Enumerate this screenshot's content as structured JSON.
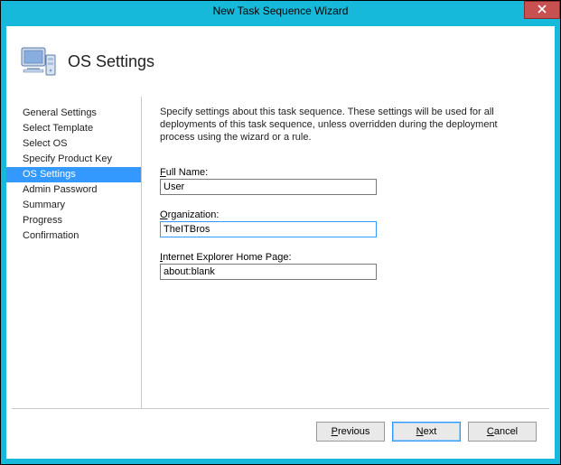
{
  "window": {
    "title": "New Task Sequence Wizard"
  },
  "header": {
    "title": "OS Settings"
  },
  "sidebar": {
    "items": [
      {
        "label": "General Settings",
        "selected": false
      },
      {
        "label": "Select Template",
        "selected": false
      },
      {
        "label": "Select OS",
        "selected": false
      },
      {
        "label": "Specify Product Key",
        "selected": false
      },
      {
        "label": "OS Settings",
        "selected": true
      },
      {
        "label": "Admin Password",
        "selected": false
      },
      {
        "label": "Summary",
        "selected": false
      },
      {
        "label": "Progress",
        "selected": false
      },
      {
        "label": "Confirmation",
        "selected": false
      }
    ]
  },
  "content": {
    "description": "Specify settings about this task sequence.  These settings will be used for all deployments of this task sequence, unless overridden during the deployment process using the wizard or a rule.",
    "fullname_label_pre": "",
    "fullname_accel": "F",
    "fullname_label_post": "ull Name:",
    "fullname_value": "User",
    "org_label_pre": "",
    "org_accel": "O",
    "org_label_post": "rganization:",
    "org_value": "TheITBros",
    "iehome_label_pre": "",
    "iehome_accel": "I",
    "iehome_label_post": "nternet Explorer Home Page:",
    "iehome_value": "about:blank"
  },
  "footer": {
    "previous_accel": "P",
    "previous_rest": "revious",
    "next_accel": "N",
    "next_rest": "ext",
    "cancel_accel": "C",
    "cancel_rest": "ancel"
  }
}
